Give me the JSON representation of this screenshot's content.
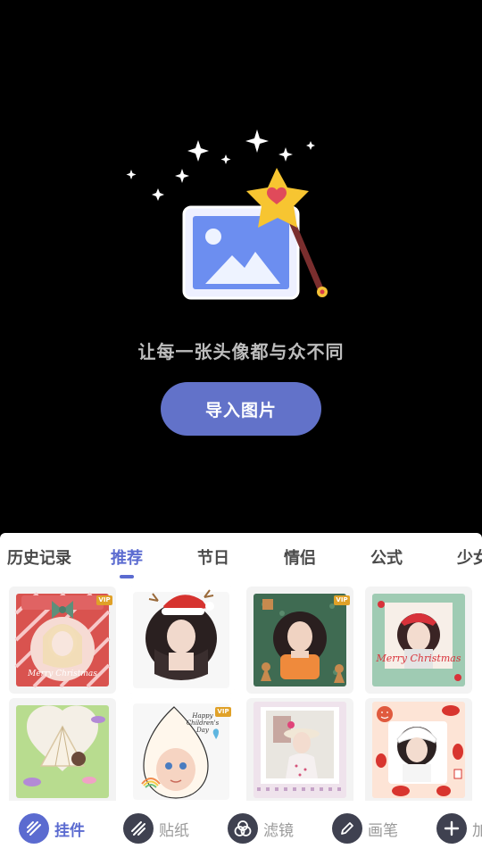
{
  "hero": {
    "tagline": "让每一张头像都与众不同",
    "import_button": "导入图片"
  },
  "categories": {
    "tabs": [
      {
        "label": "历史记录",
        "active": false
      },
      {
        "label": "推荐",
        "active": true
      },
      {
        "label": "节日",
        "active": false
      },
      {
        "label": "情侣",
        "active": false
      },
      {
        "label": "公式",
        "active": false
      },
      {
        "label": "少女",
        "active": false
      }
    ]
  },
  "templates": [
    {
      "name": "christmas-bow-frame",
      "vip": true,
      "badge": "VIP",
      "text": "Merry Christmas"
    },
    {
      "name": "santa-hat-frame",
      "vip": false
    },
    {
      "name": "gingerbread-frame",
      "vip": true,
      "badge": "VIP"
    },
    {
      "name": "christmas-wreath-frame",
      "vip": false,
      "text": "Merry Christmas"
    },
    {
      "name": "tent-heart-frame",
      "vip": false
    },
    {
      "name": "childrens-day-frame",
      "vip": true,
      "badge": "VIP",
      "text": "Happy Children's Day"
    },
    {
      "name": "polaroid-frame",
      "vip": false
    },
    {
      "name": "cow-print-frame",
      "vip": false
    }
  ],
  "toolbar": {
    "items": [
      {
        "label": "挂件",
        "icon": "pendant-icon",
        "active": true
      },
      {
        "label": "贴纸",
        "icon": "sticker-icon",
        "active": false
      },
      {
        "label": "滤镜",
        "icon": "filter-icon",
        "active": false
      },
      {
        "label": "画笔",
        "icon": "brush-icon",
        "active": false
      },
      {
        "label": "加",
        "icon": "add-icon",
        "active": false
      }
    ]
  },
  "colors": {
    "accent": "#5b6bd0",
    "button": "#6272c9",
    "background": "#000000",
    "sheet": "#ffffff"
  }
}
